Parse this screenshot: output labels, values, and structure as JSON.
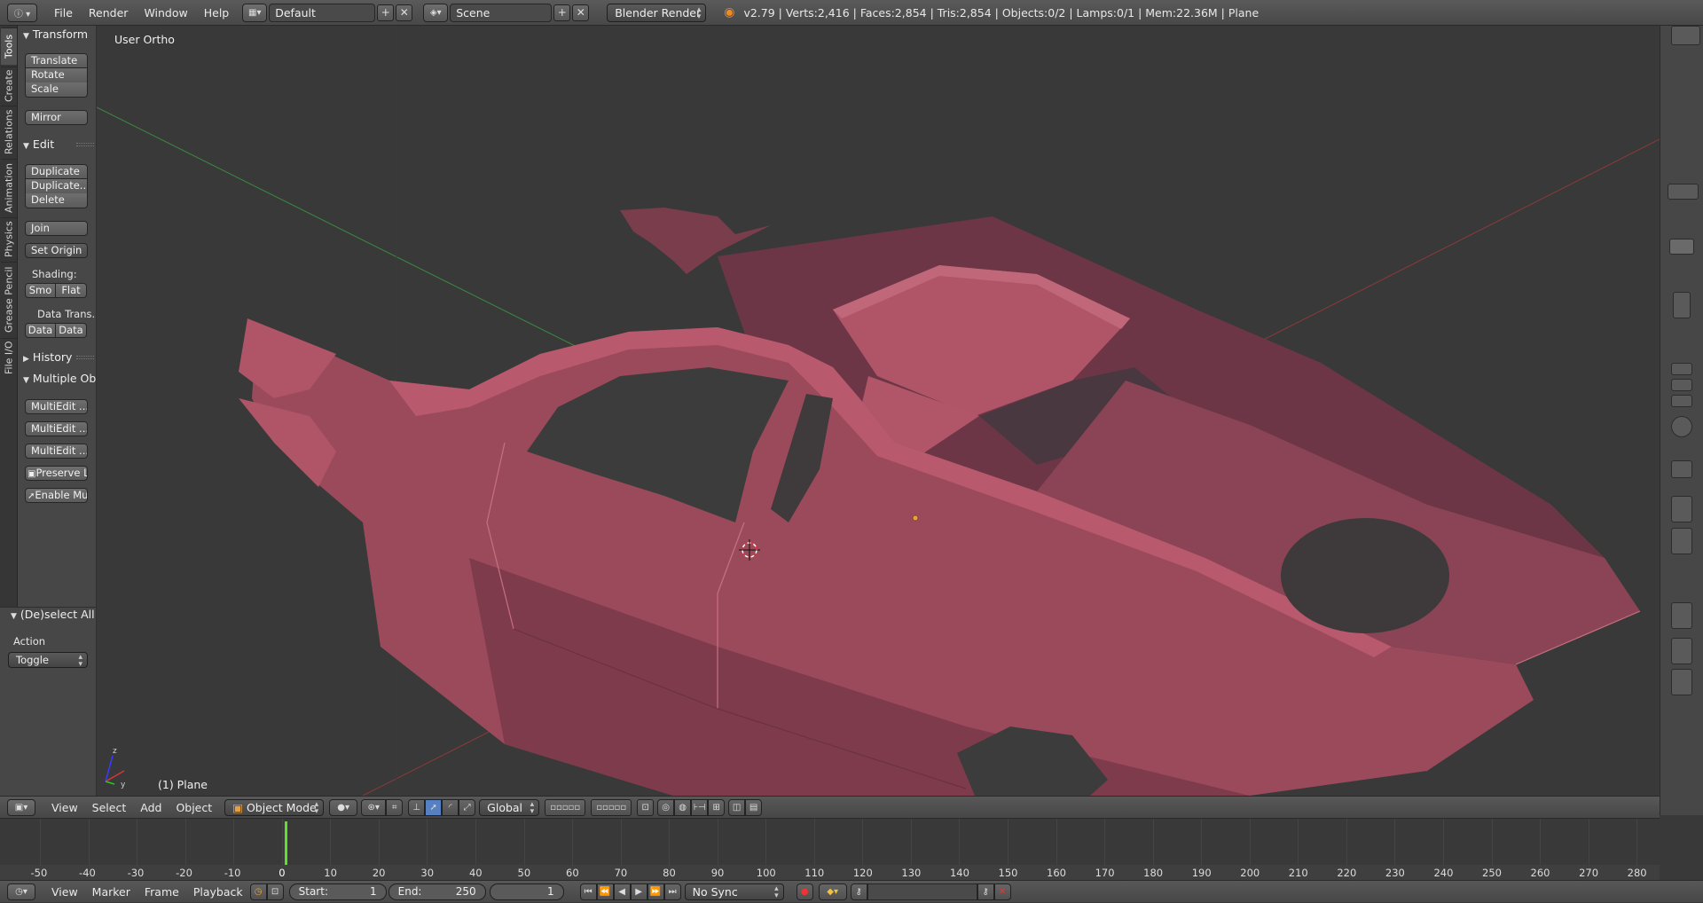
{
  "topbar": {
    "menus": [
      "File",
      "Render",
      "Window",
      "Help"
    ],
    "screen_layout": "Default",
    "scene": "Scene",
    "render_engine": "Blender Render",
    "stats": "v2.79 | Verts:2,416 | Faces:2,854 | Tris:2,854 | Objects:0/2 | Lamps:0/1 | Mem:22.36M | Plane"
  },
  "tabs": [
    "Tools",
    "Create",
    "Relations",
    "Animation",
    "Physics",
    "Grease Pencil",
    "File I/O"
  ],
  "toolshelf": {
    "transform": {
      "title": "Transform",
      "buttons": [
        "Translate",
        "Rotate",
        "Scale",
        "Mirror"
      ]
    },
    "edit": {
      "title": "Edit",
      "buttons": [
        "Duplicate",
        "Duplicate...",
        "Delete",
        "Join"
      ],
      "set_origin": "Set Origin",
      "shading_label": "Shading:",
      "smooth": "Smo",
      "flat": "Flat",
      "data_transfer_label": "Data Trans...",
      "data1": "Data",
      "data2": "Data"
    },
    "history": {
      "title": "History"
    },
    "multiple": {
      "title": "Multiple Ob",
      "buttons": [
        "MultiEdit ...",
        "MultiEdit ...",
        "MultiEdit ..."
      ],
      "preserve": "Preserve L",
      "enable": "Enable Mu"
    }
  },
  "operator": {
    "title": "(De)select All",
    "action_label": "Action",
    "action_value": "Toggle"
  },
  "viewport": {
    "view_label": "User Ortho",
    "object_label": "(1) Plane",
    "mesh_color": "#b05468",
    "grid_x_color": "#8a3a3a",
    "grid_y_color": "#3d8a3d"
  },
  "view_header": {
    "menus": [
      "View",
      "Select",
      "Add",
      "Object"
    ],
    "mode": "Object Mode",
    "orientation": "Global"
  },
  "timeline": {
    "ticks": [
      "-50",
      "-40",
      "-30",
      "-20",
      "-10",
      "0",
      "10",
      "20",
      "30",
      "40",
      "50",
      "60",
      "70",
      "80",
      "90",
      "100",
      "110",
      "120",
      "130",
      "140",
      "150",
      "160",
      "170",
      "180",
      "190",
      "200",
      "210",
      "220",
      "230",
      "240",
      "250",
      "260",
      "270",
      "280"
    ],
    "current_frame": 1
  },
  "tl_header": {
    "menus": [
      "View",
      "Marker",
      "Frame",
      "Playback"
    ],
    "start_label": "Start:",
    "start_value": "1",
    "end_label": "End:",
    "end_value": "250",
    "frame_value": "1",
    "sync": "No Sync"
  }
}
